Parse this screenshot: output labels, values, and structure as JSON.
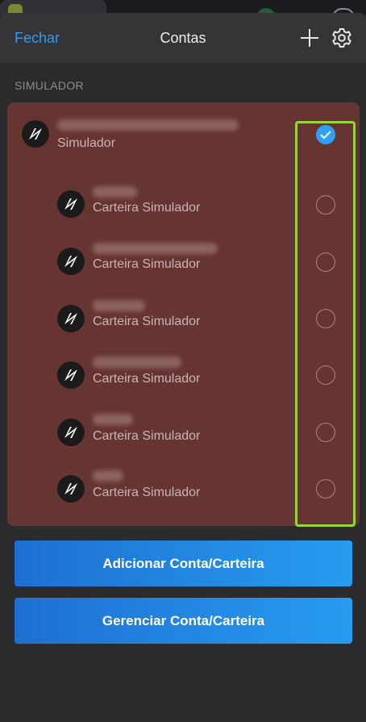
{
  "header": {
    "close_label": "Fechar",
    "title": "Contas",
    "icons": [
      "plus-icon",
      "gear-icon"
    ]
  },
  "section": {
    "label": "SIMULADOR"
  },
  "accounts": {
    "primary": {
      "subtitle": "Simulador",
      "selected": true
    },
    "wallets": [
      {
        "subtitle": "Carteira Simulador",
        "selected": false
      },
      {
        "subtitle": "Carteira Simulador",
        "selected": false
      },
      {
        "subtitle": "Carteira Simulador",
        "selected": false
      },
      {
        "subtitle": "Carteira Simulador",
        "selected": false
      },
      {
        "subtitle": "Carteira Simulador",
        "selected": false
      },
      {
        "subtitle": "Carteira Simulador",
        "selected": false
      }
    ]
  },
  "buttons": {
    "add": "Adicionar Conta/Carteira",
    "manage": "Gerenciar Conta/Carteira"
  },
  "colors": {
    "accent": "#2E9DF2",
    "accounts_background": "#663431",
    "highlight_outline": "#9BD33D"
  }
}
